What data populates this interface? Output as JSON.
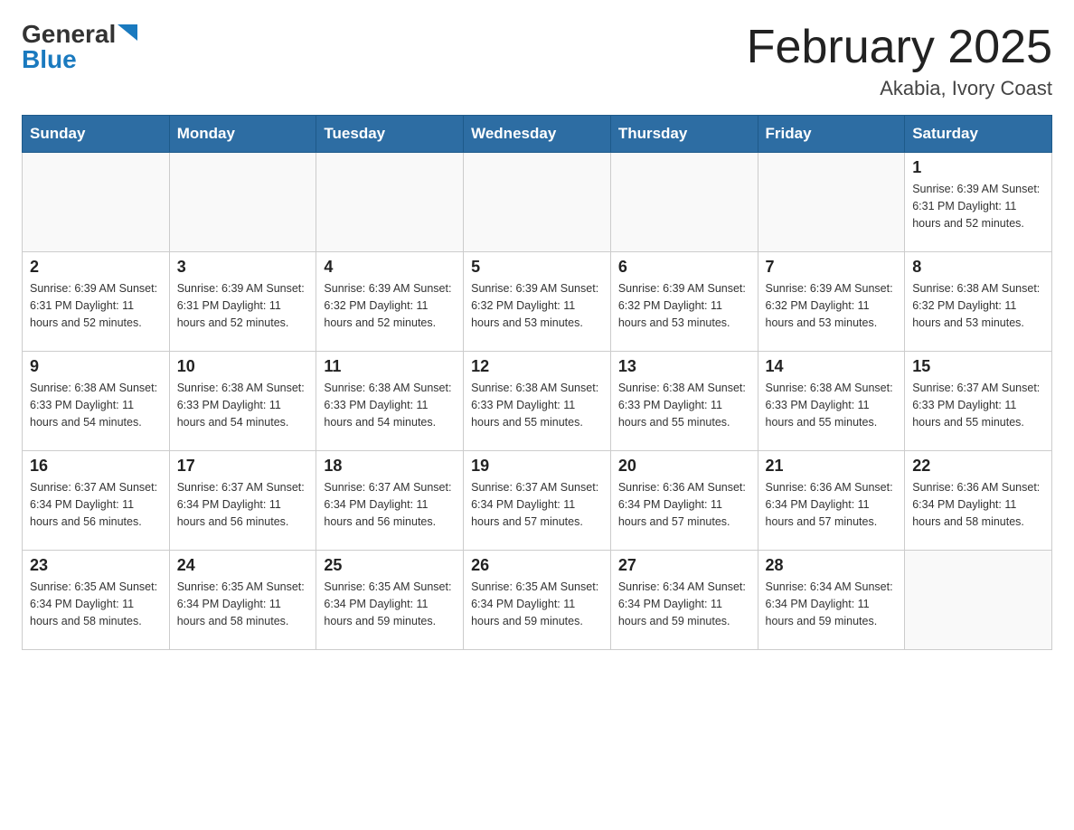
{
  "header": {
    "logo_general": "General",
    "logo_blue": "Blue",
    "month_title": "February 2025",
    "location": "Akabia, Ivory Coast"
  },
  "weekdays": [
    "Sunday",
    "Monday",
    "Tuesday",
    "Wednesday",
    "Thursday",
    "Friday",
    "Saturday"
  ],
  "weeks": [
    [
      {
        "day": "",
        "info": ""
      },
      {
        "day": "",
        "info": ""
      },
      {
        "day": "",
        "info": ""
      },
      {
        "day": "",
        "info": ""
      },
      {
        "day": "",
        "info": ""
      },
      {
        "day": "",
        "info": ""
      },
      {
        "day": "1",
        "info": "Sunrise: 6:39 AM\nSunset: 6:31 PM\nDaylight: 11 hours and 52 minutes."
      }
    ],
    [
      {
        "day": "2",
        "info": "Sunrise: 6:39 AM\nSunset: 6:31 PM\nDaylight: 11 hours and 52 minutes."
      },
      {
        "day": "3",
        "info": "Sunrise: 6:39 AM\nSunset: 6:31 PM\nDaylight: 11 hours and 52 minutes."
      },
      {
        "day": "4",
        "info": "Sunrise: 6:39 AM\nSunset: 6:32 PM\nDaylight: 11 hours and 52 minutes."
      },
      {
        "day": "5",
        "info": "Sunrise: 6:39 AM\nSunset: 6:32 PM\nDaylight: 11 hours and 53 minutes."
      },
      {
        "day": "6",
        "info": "Sunrise: 6:39 AM\nSunset: 6:32 PM\nDaylight: 11 hours and 53 minutes."
      },
      {
        "day": "7",
        "info": "Sunrise: 6:39 AM\nSunset: 6:32 PM\nDaylight: 11 hours and 53 minutes."
      },
      {
        "day": "8",
        "info": "Sunrise: 6:38 AM\nSunset: 6:32 PM\nDaylight: 11 hours and 53 minutes."
      }
    ],
    [
      {
        "day": "9",
        "info": "Sunrise: 6:38 AM\nSunset: 6:33 PM\nDaylight: 11 hours and 54 minutes."
      },
      {
        "day": "10",
        "info": "Sunrise: 6:38 AM\nSunset: 6:33 PM\nDaylight: 11 hours and 54 minutes."
      },
      {
        "day": "11",
        "info": "Sunrise: 6:38 AM\nSunset: 6:33 PM\nDaylight: 11 hours and 54 minutes."
      },
      {
        "day": "12",
        "info": "Sunrise: 6:38 AM\nSunset: 6:33 PM\nDaylight: 11 hours and 55 minutes."
      },
      {
        "day": "13",
        "info": "Sunrise: 6:38 AM\nSunset: 6:33 PM\nDaylight: 11 hours and 55 minutes."
      },
      {
        "day": "14",
        "info": "Sunrise: 6:38 AM\nSunset: 6:33 PM\nDaylight: 11 hours and 55 minutes."
      },
      {
        "day": "15",
        "info": "Sunrise: 6:37 AM\nSunset: 6:33 PM\nDaylight: 11 hours and 55 minutes."
      }
    ],
    [
      {
        "day": "16",
        "info": "Sunrise: 6:37 AM\nSunset: 6:34 PM\nDaylight: 11 hours and 56 minutes."
      },
      {
        "day": "17",
        "info": "Sunrise: 6:37 AM\nSunset: 6:34 PM\nDaylight: 11 hours and 56 minutes."
      },
      {
        "day": "18",
        "info": "Sunrise: 6:37 AM\nSunset: 6:34 PM\nDaylight: 11 hours and 56 minutes."
      },
      {
        "day": "19",
        "info": "Sunrise: 6:37 AM\nSunset: 6:34 PM\nDaylight: 11 hours and 57 minutes."
      },
      {
        "day": "20",
        "info": "Sunrise: 6:36 AM\nSunset: 6:34 PM\nDaylight: 11 hours and 57 minutes."
      },
      {
        "day": "21",
        "info": "Sunrise: 6:36 AM\nSunset: 6:34 PM\nDaylight: 11 hours and 57 minutes."
      },
      {
        "day": "22",
        "info": "Sunrise: 6:36 AM\nSunset: 6:34 PM\nDaylight: 11 hours and 58 minutes."
      }
    ],
    [
      {
        "day": "23",
        "info": "Sunrise: 6:35 AM\nSunset: 6:34 PM\nDaylight: 11 hours and 58 minutes."
      },
      {
        "day": "24",
        "info": "Sunrise: 6:35 AM\nSunset: 6:34 PM\nDaylight: 11 hours and 58 minutes."
      },
      {
        "day": "25",
        "info": "Sunrise: 6:35 AM\nSunset: 6:34 PM\nDaylight: 11 hours and 59 minutes."
      },
      {
        "day": "26",
        "info": "Sunrise: 6:35 AM\nSunset: 6:34 PM\nDaylight: 11 hours and 59 minutes."
      },
      {
        "day": "27",
        "info": "Sunrise: 6:34 AM\nSunset: 6:34 PM\nDaylight: 11 hours and 59 minutes."
      },
      {
        "day": "28",
        "info": "Sunrise: 6:34 AM\nSunset: 6:34 PM\nDaylight: 11 hours and 59 minutes."
      },
      {
        "day": "",
        "info": ""
      }
    ]
  ]
}
